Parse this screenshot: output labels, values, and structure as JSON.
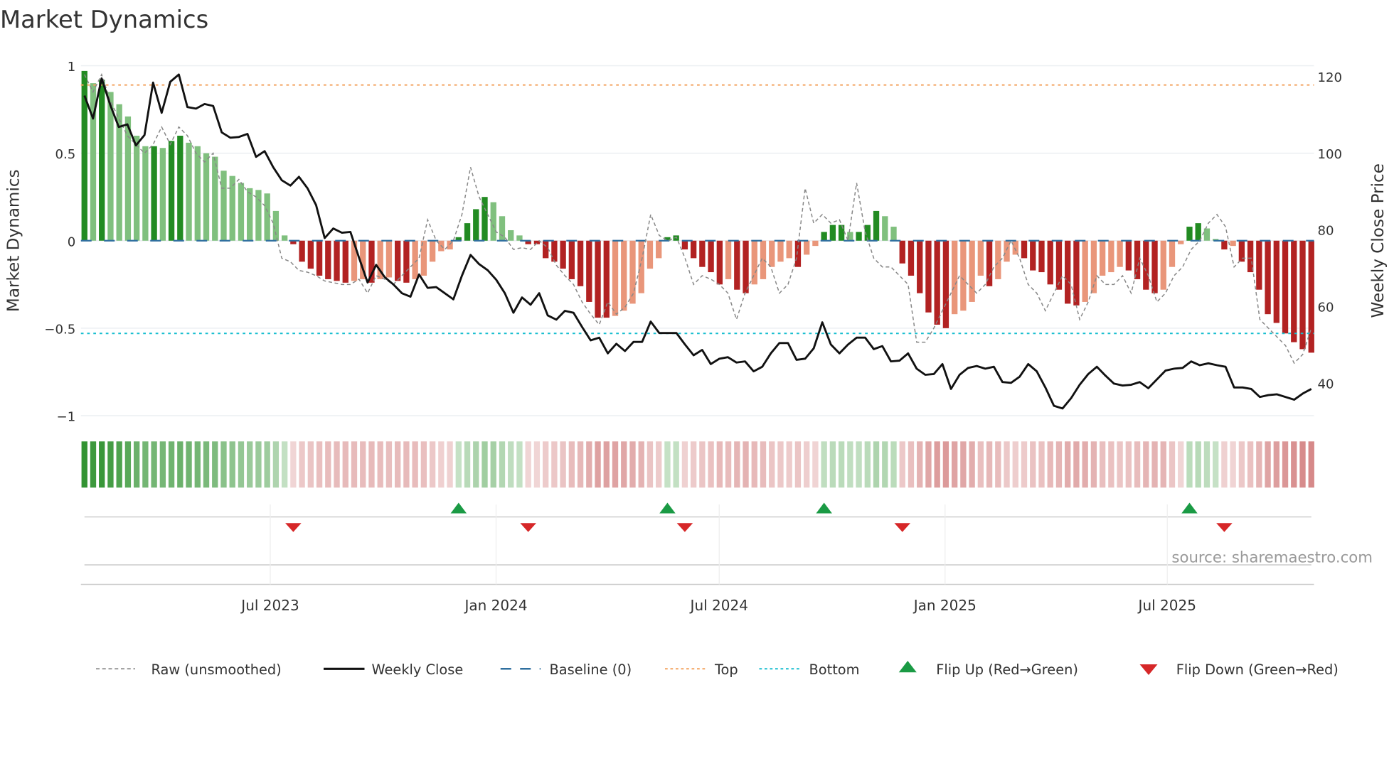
{
  "chart_data": {
    "type": "bar",
    "title": "Market Dynamics",
    "ylabel_left": "Market Dynamics",
    "ylabel_right": "Weekly Close Price",
    "ylim_left": [
      -1,
      1
    ],
    "ylim_right": [
      31.2,
      122.8
    ],
    "left_ticks": [
      {
        "v": 1,
        "label": "1"
      },
      {
        "v": 0.5,
        "label": "0.5"
      },
      {
        "v": 0,
        "label": "0"
      },
      {
        "v": -0.5,
        "label": "−0.5"
      },
      {
        "v": -1,
        "label": "−1"
      }
    ],
    "right_ticks": [
      {
        "v": 120,
        "label": "120"
      },
      {
        "v": 100,
        "label": "100"
      },
      {
        "v": 80,
        "label": "80"
      },
      {
        "v": 60,
        "label": "60"
      },
      {
        "v": 40,
        "label": "40"
      }
    ],
    "x_ticks": [
      "Jul 2023",
      "Jan 2024",
      "Jul 2024",
      "Jan 2025",
      "Jul 2025"
    ],
    "frequency": "weekly",
    "top_level": 0.89,
    "bottom_level": -0.53,
    "baseline": 0,
    "grid": true,
    "colors": {
      "green_strong": "#228b22",
      "green_light": "#80c07e",
      "red_strong": "#b22222",
      "red_light": "#e9967a",
      "raw": "#888888",
      "close": "#111111",
      "baseline": "#2f6f9f",
      "top": "#f4a460",
      "bottom": "#17becf",
      "flip_up": "#1a9a44",
      "flip_down": "#d62728"
    },
    "dynamics": [
      0.97,
      0.9,
      0.92,
      0.85,
      0.78,
      0.71,
      0.6,
      0.54,
      0.54,
      0.53,
      0.57,
      0.6,
      0.56,
      0.54,
      0.5,
      0.48,
      0.4,
      0.37,
      0.33,
      0.3,
      0.29,
      0.27,
      0.17,
      0.03,
      -0.02,
      -0.12,
      -0.16,
      -0.2,
      -0.22,
      -0.23,
      -0.24,
      -0.23,
      -0.22,
      -0.24,
      -0.22,
      -0.21,
      -0.23,
      -0.24,
      -0.22,
      -0.2,
      -0.12,
      -0.06,
      -0.05,
      0.02,
      0.1,
      0.18,
      0.25,
      0.22,
      0.14,
      0.06,
      0.03,
      -0.02,
      -0.02,
      -0.1,
      -0.12,
      -0.16,
      -0.22,
      -0.26,
      -0.35,
      -0.44,
      -0.44,
      -0.43,
      -0.4,
      -0.36,
      -0.3,
      -0.16,
      -0.1,
      0.02,
      0.03,
      -0.05,
      -0.1,
      -0.15,
      -0.18,
      -0.25,
      -0.22,
      -0.28,
      -0.3,
      -0.25,
      -0.22,
      -0.15,
      -0.12,
      -0.1,
      -0.15,
      -0.08,
      -0.03,
      0.05,
      0.09,
      0.09,
      0.05,
      0.05,
      0.09,
      0.17,
      0.14,
      0.08,
      -0.13,
      -0.2,
      -0.3,
      -0.41,
      -0.48,
      -0.5,
      -0.42,
      -0.4,
      -0.35,
      -0.2,
      -0.26,
      -0.22,
      -0.12,
      -0.08,
      -0.1,
      -0.17,
      -0.18,
      -0.25,
      -0.28,
      -0.36,
      -0.37,
      -0.35,
      -0.3,
      -0.2,
      -0.18,
      -0.15,
      -0.17,
      -0.22,
      -0.28,
      -0.3,
      -0.28,
      -0.15,
      -0.02,
      0.08,
      0.1,
      0.07,
      0.01,
      -0.05,
      -0.03,
      -0.12,
      -0.18,
      -0.28,
      -0.42,
      -0.47,
      -0.53,
      -0.58,
      -0.62,
      -0.64
    ],
    "raw": [
      0.95,
      0.85,
      0.95,
      0.8,
      0.7,
      0.6,
      0.55,
      0.5,
      0.55,
      0.65,
      0.55,
      0.65,
      0.6,
      0.5,
      0.45,
      0.5,
      0.3,
      0.3,
      0.35,
      0.28,
      0.25,
      0.2,
      0.1,
      -0.1,
      -0.12,
      -0.17,
      -0.18,
      -0.2,
      -0.23,
      -0.24,
      -0.25,
      -0.25,
      -0.22,
      -0.3,
      -0.2,
      -0.22,
      -0.25,
      -0.2,
      -0.15,
      -0.1,
      0.12,
      0,
      -0.05,
      0.0,
      0.15,
      0.42,
      0.25,
      0.15,
      0.05,
      0.02,
      -0.05,
      -0.04,
      -0.05,
      0,
      -0.04,
      -0.14,
      -0.2,
      -0.25,
      -0.35,
      -0.42,
      -0.48,
      -0.35,
      -0.42,
      -0.38,
      -0.3,
      -0.1,
      0.15,
      0.03,
      0,
      0.02,
      -0.1,
      -0.25,
      -0.2,
      -0.22,
      -0.25,
      -0.3,
      -0.45,
      -0.3,
      -0.2,
      -0.1,
      -0.15,
      -0.3,
      -0.25,
      -0.1,
      0.3,
      0.1,
      0.15,
      0.1,
      0.12,
      0.0,
      0.33,
      0.05,
      -0.1,
      -0.15,
      -0.15,
      -0.2,
      -0.25,
      -0.58,
      -0.58,
      -0.5,
      -0.4,
      -0.3,
      -0.2,
      -0.25,
      -0.3,
      -0.25,
      -0.15,
      -0.1,
      0.0,
      -0.1,
      -0.25,
      -0.3,
      -0.4,
      -0.3,
      -0.2,
      -0.25,
      -0.45,
      -0.35,
      -0.2,
      -0.25,
      -0.25,
      -0.2,
      -0.3,
      -0.1,
      -0.2,
      -0.35,
      -0.3,
      -0.2,
      -0.15,
      -0.05,
      0,
      0.1,
      0.15,
      0.08,
      -0.15,
      -0.1,
      -0.1,
      -0.45,
      -0.5,
      -0.55,
      -0.6,
      -0.7,
      -0.65,
      -0.5
    ],
    "close": [
      115,
      109,
      119.5,
      112.6,
      106.8,
      107.5,
      102,
      104.7,
      118.4,
      110.5,
      118.6,
      120.5,
      112,
      111.6,
      112.8,
      112.3,
      105.4,
      104,
      104.2,
      105,
      99,
      100.5,
      96.3,
      92.9,
      91.5,
      93.8,
      90.8,
      86.4,
      77.8,
      80.3,
      79.2,
      79.4,
      72.7,
      66.2,
      70.8,
      67.6,
      65.7,
      63.4,
      62.5,
      68.3,
      64.8,
      65,
      63.4,
      61.8,
      68,
      73.4,
      71,
      69.4,
      66.9,
      63.4,
      58.3,
      62.3,
      60.4,
      63.4,
      57.6,
      56.5,
      58.8,
      58.3,
      54.6,
      51.1,
      51.8,
      47.7,
      50.2,
      48.3,
      50.7,
      50.7,
      56,
      53,
      53,
      53,
      50,
      47.2,
      48.6,
      44.9,
      46.3,
      46.7,
      45.3,
      45.6,
      43,
      44.2,
      47.7,
      50.4,
      50.4,
      46,
      46.3,
      49,
      55.8,
      50,
      47.7,
      50,
      51.8,
      51.8,
      48.8,
      49.6,
      45.6,
      45.8,
      47.7,
      43.7,
      42.1,
      42.3,
      44.9,
      38.4,
      42.1,
      43.9,
      44.4,
      43.7,
      44.2,
      40.2,
      40,
      41.6,
      44.9,
      43,
      38.8,
      34,
      33.3,
      36,
      39.5,
      42.3,
      44.2,
      41.9,
      39.8,
      39.3,
      39.5,
      40.2,
      38.6,
      40.9,
      43.2,
      43.7,
      43.9,
      45.6,
      44.6,
      45.1,
      44.6,
      44.2,
      38.8,
      38.8,
      38.4,
      36.3,
      36.8,
      37,
      36.3,
      35.6,
      37.2,
      38.4
    ],
    "legend": [
      "Raw (unsmoothed)",
      "Weekly Close",
      "Baseline (0)",
      "Top",
      "Bottom",
      "Flip Up (Red→Green)",
      "Flip Down (Green→Red)"
    ],
    "legend_placement": "bottom",
    "source": "source: sharemaestro.com"
  }
}
